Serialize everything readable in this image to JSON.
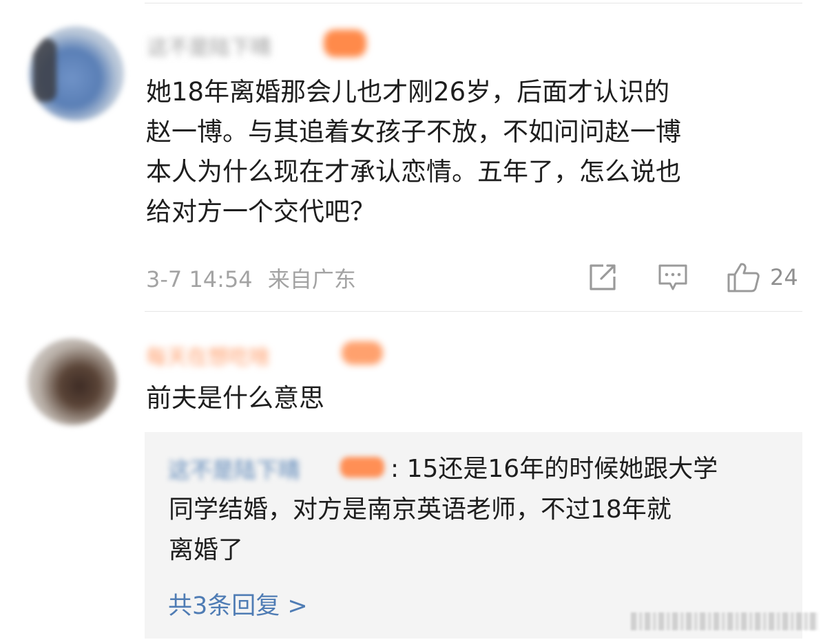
{
  "comment1": {
    "username": "这不是陆下晴",
    "lines": [
      "她18年离婚那会儿也才刚26岁，后面才认识的",
      "赵一博。与其追着女孩子不放，不如问问赵一博",
      "本人为什么现在才承认恋情。五年了，怎么说也",
      "给对方一个交代吧？"
    ],
    "date": "3-7 14:54",
    "location": "来自广东",
    "like_count": "24"
  },
  "comment2": {
    "username": "每天在想吃啥",
    "text": "前夫是什么意思",
    "reply": {
      "author": "这不是陆下晴",
      "lines": [
        ": 15还是16年的时候她跟大学",
        "同学结婚，对方是南京英语老师，不过18年就",
        "离婚了"
      ],
      "more_label": "共3条回复 >"
    }
  },
  "colors": {
    "link_blue": "#4f7cb4",
    "meta_gray": "#a3a3a3",
    "badge_orange": "#ff8a4a",
    "reply_bg": "#f4f4f4"
  }
}
